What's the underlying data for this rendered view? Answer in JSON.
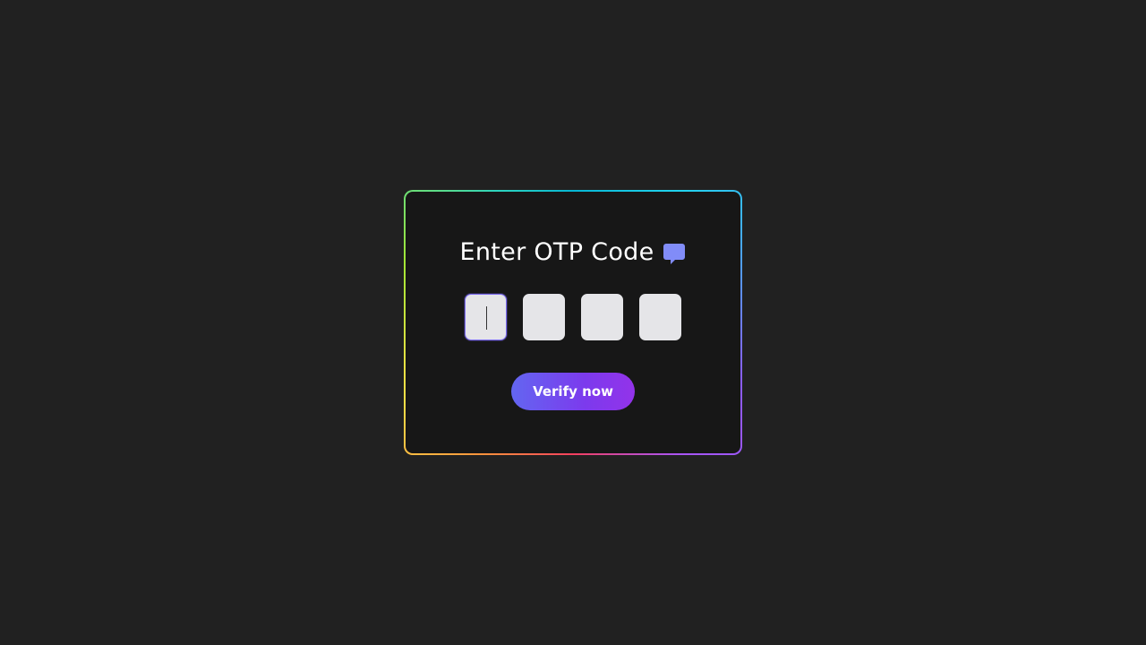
{
  "otp": {
    "title": "Enter OTP Code",
    "title_icon": "chat-bubble-icon",
    "digits": [
      "",
      "",
      "",
      ""
    ],
    "active_index": 0,
    "verify_label": "Verify now"
  },
  "colors": {
    "page_background": "#212121",
    "card_background": "#171717",
    "icon_color": "#818cf8",
    "button_gradient_start": "#6366f1",
    "button_gradient_end": "#9333ea"
  }
}
